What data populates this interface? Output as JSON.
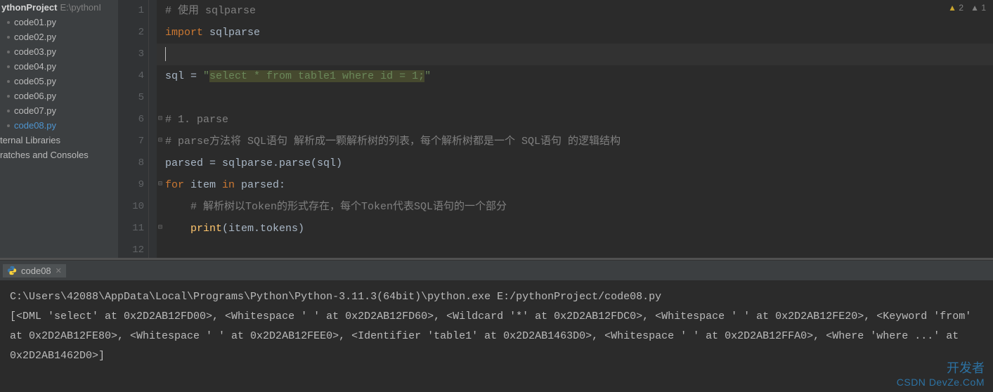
{
  "project": {
    "name": "ythonProject",
    "path": "E:\\pythonI",
    "files": [
      {
        "label": "code01.py",
        "selected": false
      },
      {
        "label": "code02.py",
        "selected": false
      },
      {
        "label": "code03.py",
        "selected": false
      },
      {
        "label": "code04.py",
        "selected": false
      },
      {
        "label": "code05.py",
        "selected": false
      },
      {
        "label": "code06.py",
        "selected": false
      },
      {
        "label": "code07.py",
        "selected": false
      },
      {
        "label": "code08.py",
        "selected": true
      }
    ],
    "extras": [
      "ternal Libraries",
      "ratches and Consoles"
    ]
  },
  "problems": {
    "warn_count": "2",
    "weak_count": "1"
  },
  "editor": {
    "lines": [
      "1",
      "2",
      "3",
      "4",
      "5",
      "6",
      "7",
      "8",
      "9",
      "10",
      "11",
      "12"
    ],
    "l1_cmt": "# 使用 sqlparse",
    "l2_kw": "import ",
    "l2_mod": "sqlparse",
    "l4a": "sql = ",
    "l4q1": "\"",
    "l4_hl": "select * from table1 where id = 1;",
    "l4q2": "\"",
    "l6_cmt": "# 1. parse",
    "l7_cmt": "# parse方法将 SQL语句 解析成一颗解析树的列表，每个解析树都是一个 SQL语句 的逻辑结构",
    "l8a": "parsed = sqlparse.parse(sql)",
    "l9_for": "for ",
    "l9_item": "item ",
    "l9_in": "in ",
    "l9_iter": "parsed:",
    "l10_cmt": "    # 解析树以Token的形式存在，每个Token代表SQL语句的一个部分",
    "l11a": "    ",
    "l11_fn": "print",
    "l11b": "(item.tokens)"
  },
  "run": {
    "tab_name": "code08",
    "out1": "C:\\Users\\42088\\AppData\\Local\\Programs\\Python\\Python-3.11.3(64bit)\\python.exe E:/pythonProject/code08.py",
    "out2": "[<DML 'select' at 0x2D2AB12FD00>, <Whitespace ' ' at 0x2D2AB12FD60>, <Wildcard '*' at 0x2D2AB12FDC0>, <Whitespace ' ' at 0x2D2AB12FE20>, <Keyword 'from' at 0x2D2AB12FE80>, <Whitespace ' ' at 0x2D2AB12FEE0>, <Identifier 'table1' at 0x2D2AB1463D0>, <Whitespace ' ' at 0x2D2AB12FFA0>, <Where 'where ...' at 0x2D2AB1462D0>]"
  },
  "watermark": {
    "cn": "开发者",
    "en1": "CSDN",
    "en2": "DevZe.CoM"
  }
}
